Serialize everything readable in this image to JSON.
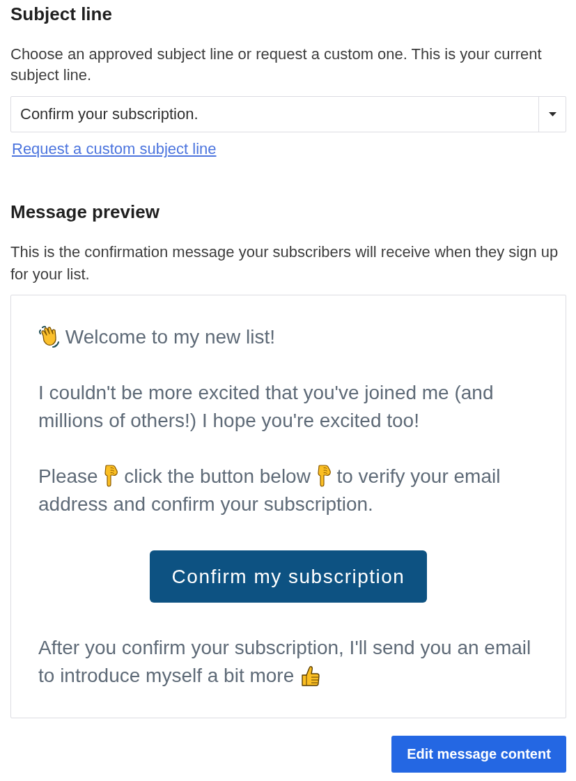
{
  "subject_section": {
    "heading": "Subject line",
    "description": "Choose an approved subject line or request a custom one. This is your current subject line.",
    "select": {
      "value": "Confirm your subscription."
    },
    "link": "Request a custom subject line"
  },
  "preview_section": {
    "heading": "Message preview",
    "description": "This is the confirmation message your subscribers will receive when they sign up for your list.",
    "blocks": [
      {
        "kind": "paragraph",
        "lines": [
          [
            {
              "kind": "wave"
            },
            {
              "kind": "text",
              "text": "Welcome to my new list!"
            }
          ]
        ]
      },
      {
        "kind": "paragraph",
        "lines": [
          [
            {
              "kind": "text",
              "text": "I couldn't be more excited that you've joined me (and millions of others!) I hope you're excited too!"
            }
          ]
        ]
      },
      {
        "kind": "paragraph",
        "lines": [
          [
            {
              "kind": "text",
              "text": "Please"
            },
            {
              "kind": "pointdown"
            },
            {
              "kind": "text",
              "text": "click the button below"
            },
            {
              "kind": "pointdown"
            },
            {
              "kind": "text",
              "text": "to verify your email"
            }
          ],
          [
            {
              "kind": "text",
              "text": "address and confirm your subscription."
            }
          ]
        ]
      },
      {
        "kind": "button",
        "label": "Confirm my subscription"
      },
      {
        "kind": "paragraph",
        "lines": [
          [
            {
              "kind": "text",
              "text": "After you confirm your subscription, I'll send you an email"
            }
          ],
          [
            {
              "kind": "text",
              "text": "to introduce myself a bit more"
            },
            {
              "kind": "thumbsup"
            }
          ]
        ]
      }
    ]
  },
  "edit_button": "Edit message content"
}
